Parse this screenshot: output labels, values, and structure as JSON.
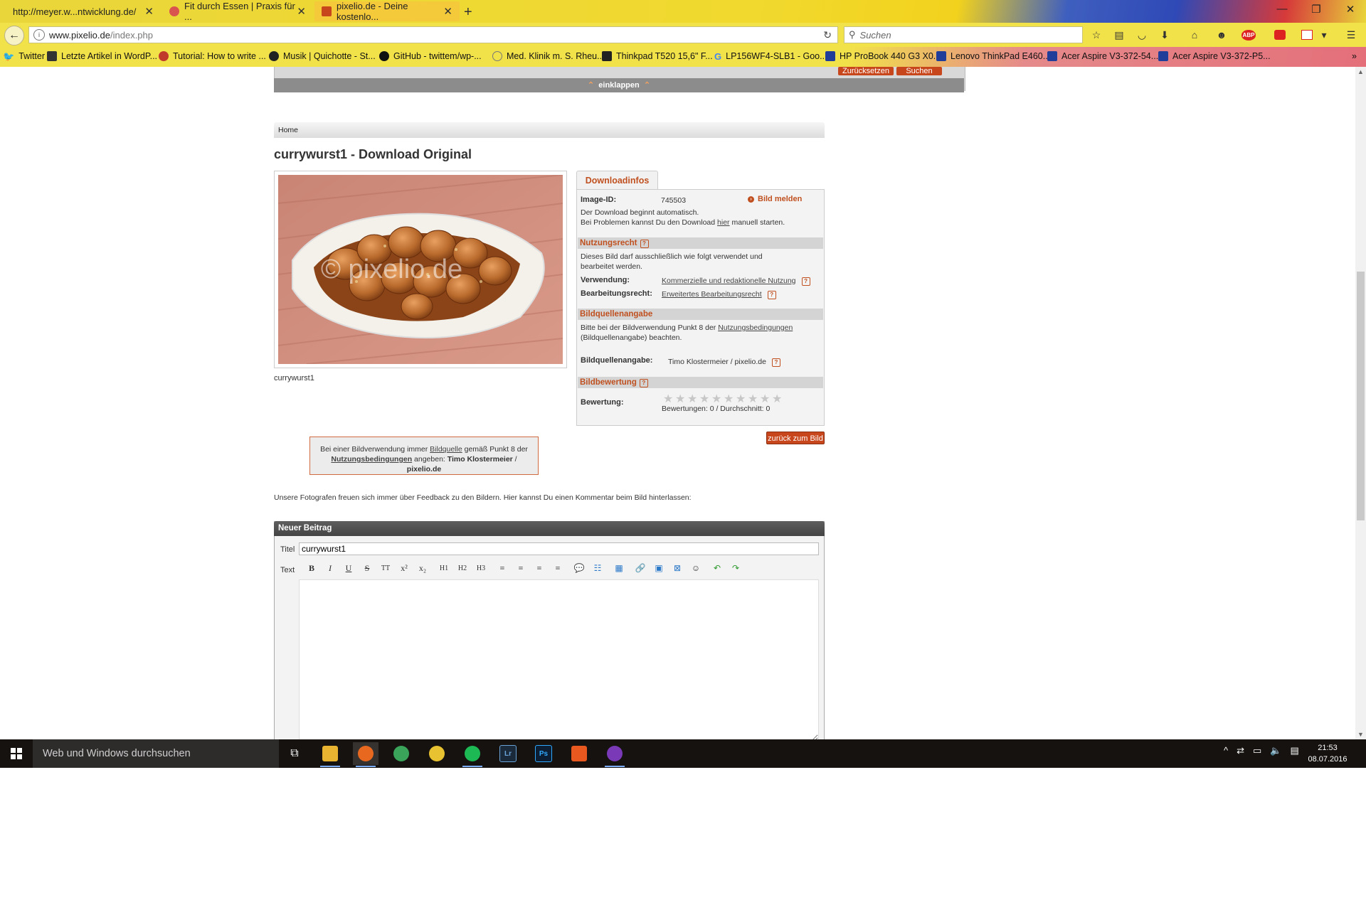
{
  "browser": {
    "tabs": [
      {
        "label": "http://meyer.w...ntwicklung.de/",
        "active": false
      },
      {
        "label": "Fit durch Essen | Praxis für ...",
        "active": false
      },
      {
        "label": "pixelio.de - Deine kostenlo...",
        "active": true
      }
    ],
    "new_tab": "+",
    "url_host": "www.pixelio.de",
    "url_path": "/index.php",
    "search_placeholder": "Suchen",
    "bookmarks": [
      {
        "label": "Twitter",
        "color": "#1da1f2"
      },
      {
        "label": "Letzte Artikel in WordP...",
        "color": "#333333"
      },
      {
        "label": "Tutorial: How to write ...",
        "color": "#c0392b"
      },
      {
        "label": "Musik | Quichotte - St...",
        "color": "#222222"
      },
      {
        "label": "GitHub - twittem/wp-...",
        "color": "#111111"
      },
      {
        "label": "Med. Klinik m. S. Rheu...",
        "color": "#777777"
      },
      {
        "label": "Thinkpad T520 15,6\" F...",
        "color": "#222222"
      },
      {
        "label": "LP156WF4-SLB1 - Goo...",
        "color": "#4285f4"
      },
      {
        "label": "HP ProBook 440 G3 X0...",
        "color": "#1f3d99"
      },
      {
        "label": "Lenovo ThinkPad E460...",
        "color": "#1f3d99"
      },
      {
        "label": "Acer Aspire V3-372-54...",
        "color": "#1f3d99"
      },
      {
        "label": "Acer Aspire V3-372-P5...",
        "color": "#1f3d99"
      }
    ],
    "bookmarks_more": "»"
  },
  "page": {
    "search_reset": "Zurücksetzen",
    "search_submit": "Suchen",
    "collapse_label": "einklappen",
    "breadcrumb": "Home",
    "title": "currywurst1 - Download Original",
    "watermark": "© pixelio.de",
    "caption": "currywurst1",
    "info": {
      "tab": "Downloadinfos",
      "image_id_label": "Image-ID:",
      "image_id": "745503",
      "report": "Bild melden",
      "download_auto": "Der Download beginnt automatisch.",
      "download_problem_pre": "Bei Problemen kannst Du den Download ",
      "download_problem_link": "hier",
      "download_problem_post": " manuell starten.",
      "usage_head": "Nutzungsrecht",
      "usage_text": "Dieses Bild darf ausschließlich wie folgt verwendet und bearbeitet werden.",
      "usage_label": "Verwendung:",
      "usage_value": "Kommerzielle und redaktionelle Nutzung",
      "edit_label": "Bearbeitungsrecht:",
      "edit_value": "Erweitertes Bearbeitungsrecht",
      "source_head": "Bildquellenangabe",
      "source_text_pre": "Bitte bei der Bildverwendung Punkt 8 der ",
      "source_text_link": "Nutzungsbedingungen",
      "source_text_post": "(Bildquellenangabe) beachten.",
      "source_label": "Bildquellenangabe:",
      "source_value": "Timo Klostermeier  / pixelio.de",
      "rating_head": "Bildbewertung",
      "rating_label": "Bewertung:",
      "rating_summary": "Bewertungen: 0 / Durchschnitt: 0",
      "rating_value": 0,
      "rating_max": 10
    },
    "back_button": "zurück zum Bild",
    "note": {
      "pre": "Bei einer Bildverwendung immer ",
      "link1": "Bildquelle",
      "mid": " gemäß Punkt 8 der ",
      "link2": "Nutzungsbedingungen",
      "post": " angeben: ",
      "author": "Timo Klostermeier",
      "sep": "  /  ",
      "site": "pixelio.de"
    },
    "feedback": "Unsere Fotografen freuen sich immer über Feedback zu den Bildern. Hier kannst Du einen Kommentar beim Bild hinterlassen:",
    "post": {
      "header": "Neuer Beitrag",
      "title_label": "Titel",
      "title_value": "currywurst1",
      "text_label": "Text"
    }
  },
  "taskbar": {
    "search": "Web und Windows durchsuchen",
    "time": "21:53",
    "date": "08.07.2016"
  }
}
